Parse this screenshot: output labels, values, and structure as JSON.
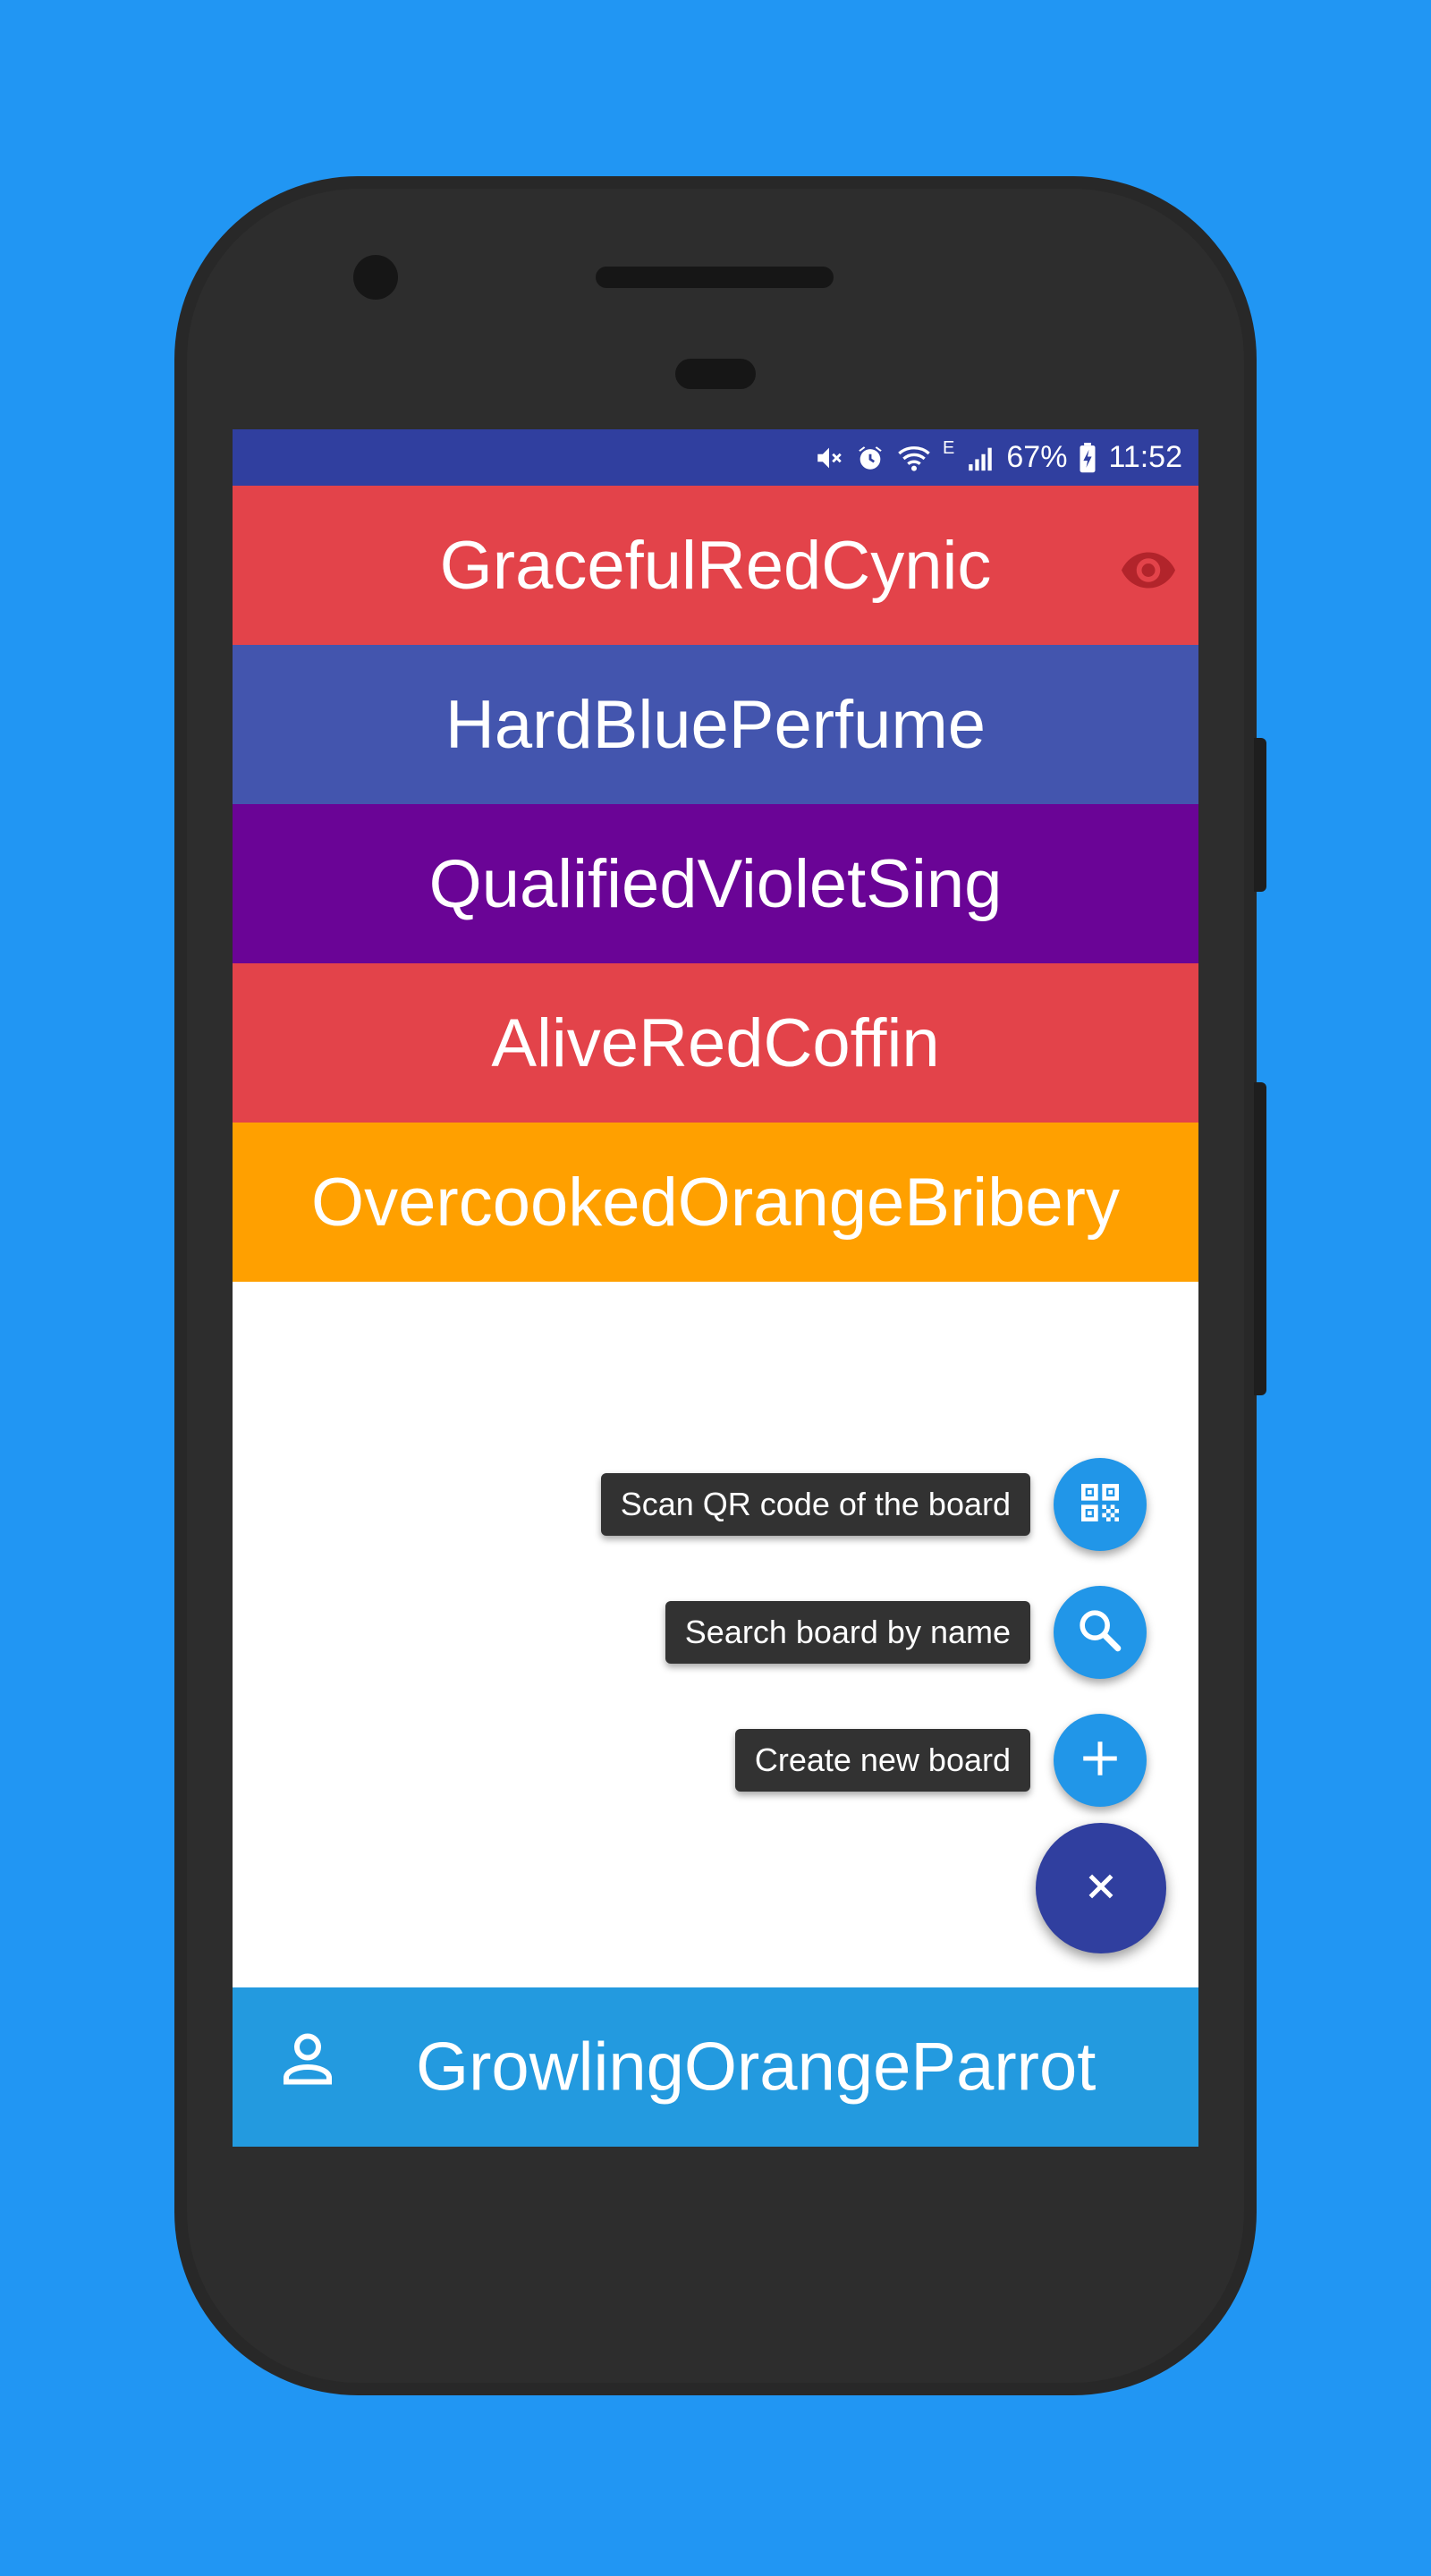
{
  "status_bar": {
    "battery": "67%",
    "time": "11:52",
    "network_type": "E",
    "icons": [
      "mute-icon",
      "alarm-icon",
      "wifi-icon",
      "signal-icon",
      "battery-charging-icon"
    ]
  },
  "boards": [
    {
      "name": "GracefulRedCynic",
      "color": "#E3434A",
      "watched": true
    },
    {
      "name": "HardBluePerfume",
      "color": "#4355AE"
    },
    {
      "name": "QualifiedVioletSing",
      "color": "#6A0496"
    },
    {
      "name": "AliveRedCoffin",
      "color": "#E3434A"
    },
    {
      "name": "OvercookedOrangeBribery",
      "color": "#FFA000"
    }
  ],
  "fab_menu": {
    "scan_label": "Scan QR code of the board",
    "search_label": "Search board by name",
    "create_label": "Create new board",
    "scan_icon": "qr-code-icon",
    "search_icon": "search-icon",
    "create_icon": "plus-icon",
    "close_icon": "close-icon",
    "mini_fab_color": "#2196E8",
    "main_fab_color": "#303F9F"
  },
  "user": {
    "name": "GrowlingOrangeParrot",
    "icon": "person-icon",
    "bar_color": "#239ADF"
  }
}
